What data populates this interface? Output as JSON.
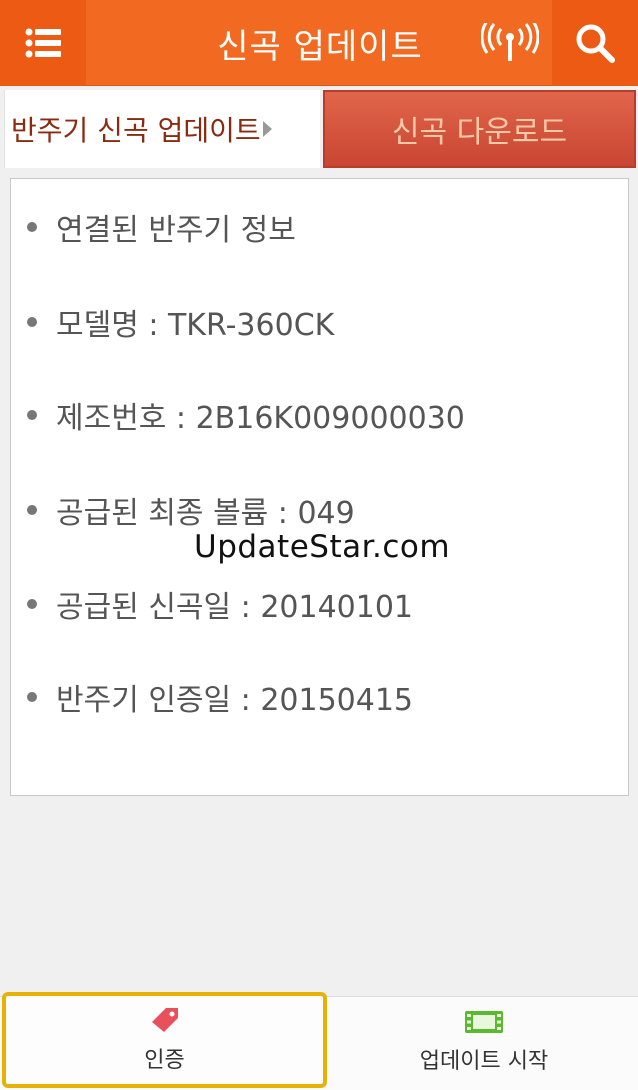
{
  "header": {
    "title": "신곡 업데이트",
    "menu_icon": "list-menu-icon",
    "signal_icon": "broadcast-signal-icon",
    "search_icon": "search-icon",
    "colors": {
      "bar": "#f26a21",
      "button": "#ec5a13"
    }
  },
  "tabs": [
    {
      "label": "반주기 신곡 업데이트",
      "active": true
    },
    {
      "label": "신곡 다운로드",
      "active": false
    }
  ],
  "info": {
    "items": [
      "연결된 반주기 정보",
      "모델명 : TKR-360CK",
      "제조번호 : 2B16K009000030",
      "공급된 최종 볼륨 : 049",
      "공급된 신곡일 : 20140101",
      "반주기 인증일 : 20150415"
    ],
    "watermark": "UpdateStar.com"
  },
  "bottom": {
    "auth_label": "인증",
    "auth_icon": "tag-icon",
    "update_label": "업데이트 시작",
    "update_icon": "film-icon",
    "highlight_color": "#e7b106"
  }
}
